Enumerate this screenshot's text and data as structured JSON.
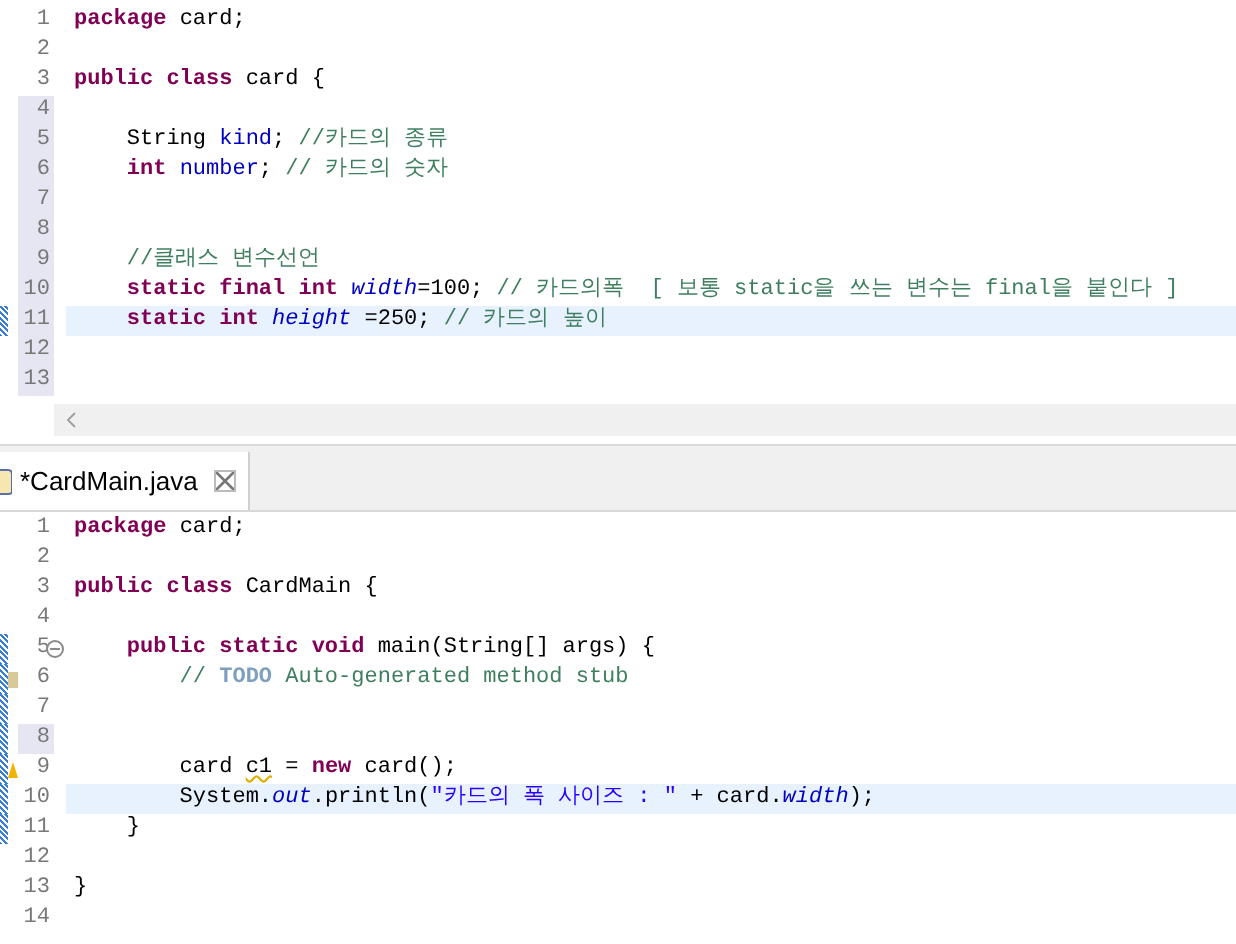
{
  "top_editor": {
    "lines": [
      {
        "number": "1",
        "added": false,
        "modified": false,
        "current": false,
        "tokens": [
          {
            "kind": "keyword",
            "text": "package"
          },
          {
            "kind": "plain",
            "text": " card;"
          }
        ]
      },
      {
        "number": "2",
        "added": false,
        "modified": false,
        "current": false
      },
      {
        "number": "3",
        "added": false,
        "modified": false,
        "current": false,
        "tokens": [
          {
            "kind": "keyword",
            "text": "public class"
          },
          {
            "kind": "plain",
            "text": " card {"
          }
        ]
      },
      {
        "number": "4",
        "added": true,
        "modified": false,
        "current": false
      },
      {
        "number": "5",
        "added": true,
        "modified": false,
        "current": false,
        "tokens": [
          {
            "kind": "plain",
            "text": "    String "
          },
          {
            "kind": "field",
            "text": "kind"
          },
          {
            "kind": "plain",
            "text": "; "
          },
          {
            "kind": "comment",
            "text": "//카드의 종류"
          }
        ]
      },
      {
        "number": "6",
        "added": true,
        "modified": false,
        "current": false,
        "tokens": [
          {
            "kind": "keyword",
            "text": "    int "
          },
          {
            "kind": "field",
            "text": "number"
          },
          {
            "kind": "plain",
            "text": "; "
          },
          {
            "kind": "comment",
            "text": "// 카드의 숫자"
          }
        ]
      },
      {
        "number": "7",
        "added": true,
        "modified": false,
        "current": false
      },
      {
        "number": "8",
        "added": true,
        "modified": false,
        "current": false
      },
      {
        "number": "9",
        "added": true,
        "modified": false,
        "current": false,
        "tokens": [
          {
            "kind": "comment",
            "text": "    //클래스 변수선언"
          }
        ]
      },
      {
        "number": "10",
        "added": true,
        "modified": false,
        "current": false,
        "tokens": [
          {
            "kind": "keyword",
            "text": "    static final int "
          },
          {
            "kind": "static",
            "text": "width"
          },
          {
            "kind": "plain",
            "text": "=100; "
          },
          {
            "kind": "comment",
            "text": "// 카드의폭  [ 보통 static을 쓰는 변수는 final을 붙인다 ]"
          }
        ]
      },
      {
        "number": "11",
        "added": true,
        "modified": true,
        "current": true,
        "tokens": [
          {
            "kind": "keyword",
            "text": "    static int "
          },
          {
            "kind": "static",
            "text": "height"
          },
          {
            "kind": "plain",
            "text": " =250; "
          },
          {
            "kind": "comment",
            "text": "// 카드의 높이"
          }
        ]
      },
      {
        "number": "12",
        "added": true,
        "modified": false,
        "current": false
      },
      {
        "number": "13",
        "added": true,
        "modified": false,
        "current": false
      }
    ]
  },
  "tab": {
    "label": "*CardMain.java",
    "selected": true
  },
  "bottom_editor": {
    "lines": [
      {
        "number": "1",
        "kind": "normal",
        "added": false,
        "modified": false,
        "current": false,
        "foldable": false,
        "tokens": [
          {
            "kind": "keyword",
            "text": "package"
          },
          {
            "kind": "plain",
            "text": " card;"
          }
        ]
      },
      {
        "number": "2",
        "kind": "normal",
        "added": false,
        "modified": false,
        "current": false,
        "foldable": false
      },
      {
        "number": "3",
        "kind": "normal",
        "added": false,
        "modified": false,
        "current": false,
        "foldable": false,
        "tokens": [
          {
            "kind": "keyword",
            "text": "public class"
          },
          {
            "kind": "plain",
            "text": " CardMain {"
          }
        ]
      },
      {
        "number": "4",
        "kind": "normal",
        "added": false,
        "modified": false,
        "current": false,
        "foldable": false
      },
      {
        "number": "5",
        "kind": "normal",
        "added": false,
        "modified": true,
        "current": false,
        "foldable": true,
        "tokens": [
          {
            "kind": "keyword",
            "text": "    public static void"
          },
          {
            "kind": "plain",
            "text": " main(String[] args) {"
          }
        ]
      },
      {
        "number": "6",
        "kind": "task",
        "added": false,
        "modified": true,
        "current": false,
        "foldable": false,
        "tokens": [
          {
            "kind": "comment",
            "text": "        // "
          },
          {
            "kind": "todo",
            "text": "TODO"
          },
          {
            "kind": "comment",
            "text": " Auto-generated method stub"
          }
        ]
      },
      {
        "number": "7",
        "kind": "normal",
        "added": false,
        "modified": true,
        "current": false,
        "foldable": false
      },
      {
        "number": "8",
        "kind": "normal",
        "added": true,
        "modified": true,
        "current": false,
        "foldable": false
      },
      {
        "number": "9",
        "kind": "warning",
        "added": false,
        "modified": true,
        "current": false,
        "foldable": false,
        "tokens": [
          {
            "kind": "plain",
            "text": "        card "
          },
          {
            "kind": "warning",
            "text": "c1"
          },
          {
            "kind": "plain",
            "text": " = "
          },
          {
            "kind": "keyword",
            "text": "new"
          },
          {
            "kind": "plain",
            "text": " card();"
          }
        ]
      },
      {
        "number": "10",
        "kind": "normal",
        "added": false,
        "modified": true,
        "current": true,
        "foldable": false,
        "tokens": [
          {
            "kind": "plain",
            "text": "        System."
          },
          {
            "kind": "static",
            "text": "out"
          },
          {
            "kind": "plain",
            "text": ".println("
          },
          {
            "kind": "string",
            "text": "\"카드의 폭 사이즈 : \""
          },
          {
            "kind": "plain",
            "text": " + card."
          },
          {
            "kind": "static",
            "text": "width"
          },
          {
            "kind": "plain",
            "text": ");"
          }
        ]
      },
      {
        "number": "11",
        "kind": "normal",
        "added": false,
        "modified": true,
        "current": false,
        "foldable": false,
        "tokens": [
          {
            "kind": "plain",
            "text": "    }"
          }
        ]
      },
      {
        "number": "12",
        "kind": "normal",
        "added": false,
        "modified": false,
        "current": false,
        "foldable": false
      },
      {
        "number": "13",
        "kind": "normal",
        "added": false,
        "modified": false,
        "current": false,
        "foldable": false,
        "tokens": [
          {
            "kind": "plain",
            "text": "}"
          }
        ]
      },
      {
        "number": "14",
        "kind": "normal",
        "added": false,
        "modified": false,
        "current": false,
        "foldable": false
      }
    ]
  }
}
